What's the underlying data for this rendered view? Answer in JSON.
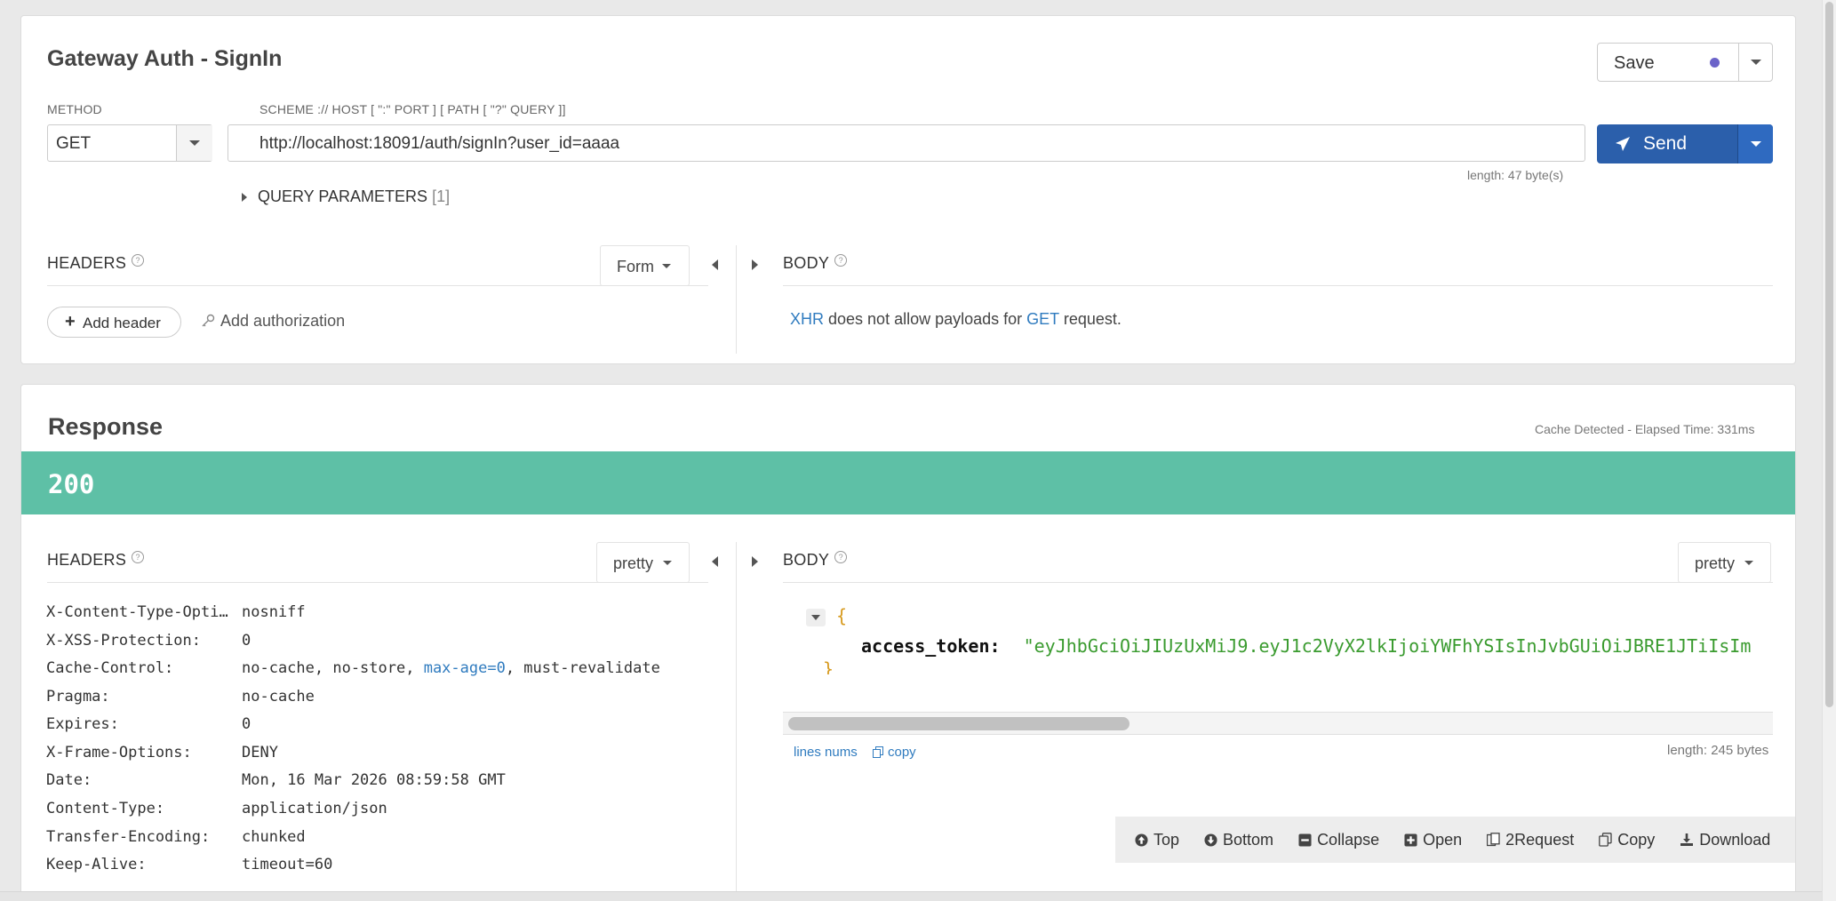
{
  "request": {
    "title": "Gateway Auth - SignIn",
    "save_label": "Save",
    "method_label": "METHOD",
    "method_value": "GET",
    "url_label": "SCHEME :// HOST [ \":\" PORT ] [ PATH [ \"?\" QUERY ]]",
    "url_value": "http://localhost:18091/auth/signIn?user_id=aaaa",
    "send_label": "Send",
    "length_text": "length: 47 byte(s)",
    "query_params_label": "QUERY PARAMETERS",
    "query_params_count": "[1]",
    "headers_label": "HEADERS",
    "form_label": "Form",
    "add_header_label": "Add header",
    "add_auth_label": "Add authorization",
    "body_label": "BODY",
    "body_msg": {
      "xhr": "XHR",
      "middle": " does not allow payloads for ",
      "method": "GET",
      "end": " request."
    }
  },
  "response": {
    "title": "Response",
    "cache_info": "Cache Detected - Elapsed Time: 331ms",
    "status_code": "200",
    "headers_label": "HEADERS",
    "headers_view": "pretty",
    "body_label": "BODY",
    "body_view": "pretty",
    "headers": [
      {
        "key": "X-Content-Type-Opti…",
        "value": "nosniff"
      },
      {
        "key": "X-XSS-Protection:",
        "value": "0"
      },
      {
        "key": "Cache-Control:",
        "value_parts": [
          "no-cache, no-store, ",
          "max-age=0",
          ", must-revalidate"
        ]
      },
      {
        "key": "Pragma:",
        "value": "no-cache"
      },
      {
        "key": "Expires:",
        "value": "0"
      },
      {
        "key": "X-Frame-Options:",
        "value": "DENY"
      },
      {
        "key": "Date:",
        "value": "Mon, 16 Mar 2026 08:59:58 GMT"
      },
      {
        "key": "Content-Type:",
        "value": "application/json"
      },
      {
        "key": "Transfer-Encoding:",
        "value": "chunked"
      },
      {
        "key": "Keep-Alive:",
        "value": "timeout=60"
      }
    ],
    "body_json": {
      "open_brace": "{",
      "key": "access_token:",
      "value": "\"eyJhbGciOiJIUzUxMiJ9.eyJ1c2VyX2lkIjoiYWFhYSIsInJvbGUiOiJBRE1JTiIsIm",
      "close_brace": "}"
    },
    "line_nums_label": "lines nums",
    "copy_label": "copy",
    "length_text": "length: 245 bytes",
    "toolbar": {
      "top": "Top",
      "bottom": "Bottom",
      "collapse": "Collapse",
      "open": "Open",
      "to_request": "2Request",
      "copy": "Copy",
      "download": "Download"
    }
  },
  "colors": {
    "status_ok": "#5ec0a6",
    "send_button": "#2b5fab",
    "save_dot": "#6b63c9",
    "json_string": "#3a9b2f",
    "json_brace": "#d79a1e"
  }
}
